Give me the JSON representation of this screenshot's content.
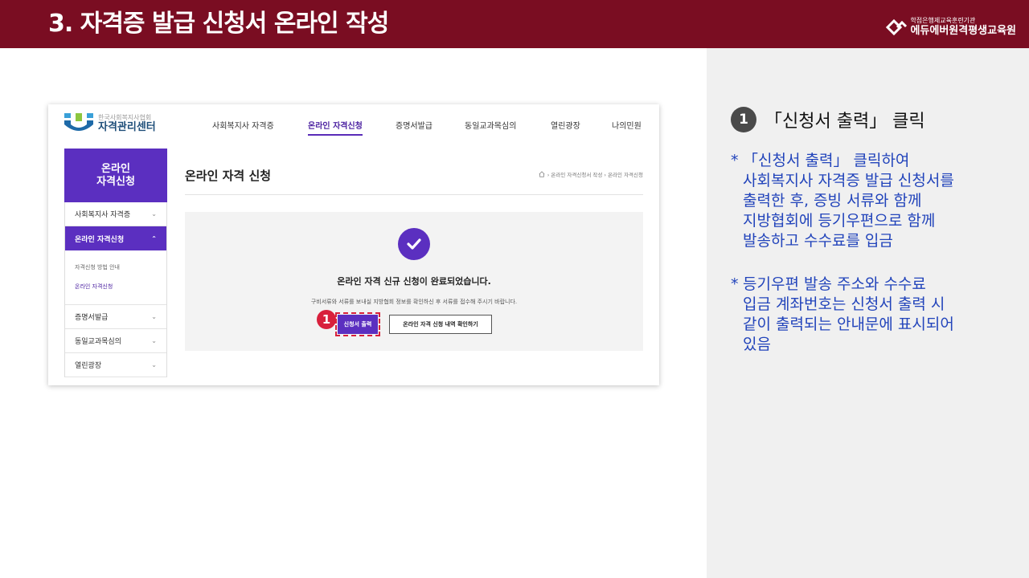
{
  "slide": {
    "title": "3. 자격증 발급 신청서 온라인 작성",
    "brand_sub": "학점은행제교육훈련기관",
    "brand_main": "에듀에버원격평생교육원"
  },
  "site": {
    "logo_sub": "한국사회복지사협회",
    "logo_main": "자격관리센터",
    "nav": [
      "사회복지사 자격증",
      "온라인 자격신청",
      "증명서발급",
      "동일교과목심의",
      "열린광장",
      "나의민원"
    ],
    "active_nav": "온라인 자격신청"
  },
  "sidebar": {
    "banner_line1": "온라인",
    "banner_line2": "자격신청",
    "items": [
      {
        "label": "사회복지사 자격증"
      },
      {
        "label": "온라인 자격신청"
      },
      {
        "label": "증명서발급"
      },
      {
        "label": "동일교과목심의"
      },
      {
        "label": "열린광장"
      }
    ],
    "sub_items": [
      {
        "label": "자격신청 방법 안내"
      },
      {
        "label": "온라인 자격신청"
      }
    ]
  },
  "content": {
    "title": "온라인 자격 신청",
    "breadcrumb": "› 온라인 자격신청서 작성 › 온라인 자격신청",
    "done_message": "온라인 자격 신규 신청이 완료되었습니다.",
    "info_message": "구비서류와 서류를 보내실 지방협회 정보를 확인하신 후 서류를 접수해 주시기 바랍니다.",
    "print_button": "신청서 출력",
    "history_button": "온라인 자격 신청 내역 확인하기",
    "marker": "1"
  },
  "instructions": {
    "step_number": "1",
    "step_text": "「신청서 출력」 클릭",
    "notes": [
      {
        "star": "*",
        "text": "「신청서 출력」 클릭하여\n사회복지사 자격증 발급 신청서를\n출력한 후, 증빙 서류와 함께\n지방협회에 등기우편으로 함께\n발송하고 수수료를 입금"
      },
      {
        "star": "*",
        "text": "등기우편 발송 주소와 수수료\n입금 계좌번호는 신청서 출력 시\n같이 출력되는 안내문에 표시되어\n있음"
      }
    ]
  },
  "colors": {
    "header_bar": "#7a0d22",
    "accent_purple": "#5b2fc0",
    "marker_red": "#d8203c",
    "note_blue": "#2244bb"
  },
  "icons": [
    "brand-logo-icon",
    "site-logo-icon",
    "chevron-down-icon",
    "chevron-up-icon",
    "home-icon",
    "check-icon"
  ]
}
